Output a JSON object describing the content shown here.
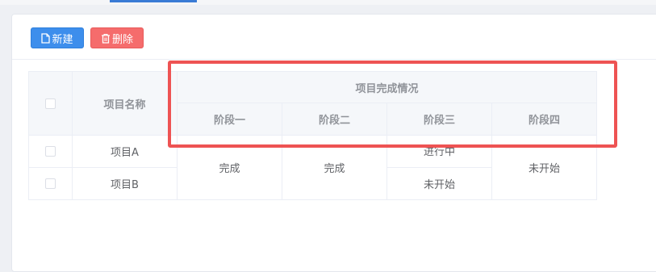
{
  "toolbar": {
    "new_label": "新建",
    "delete_label": "删除"
  },
  "table": {
    "header": {
      "name_col": "项目名称",
      "group_title": "项目完成情况",
      "stages": [
        "阶段一",
        "阶段二",
        "阶段三",
        "阶段四"
      ]
    },
    "rows": [
      {
        "name": "项目A",
        "stage3": "进行中"
      },
      {
        "name": "项目B",
        "stage3": "未开始"
      }
    ],
    "merged": {
      "stage1": "完成",
      "stage2": "完成",
      "stage4": "未开始"
    }
  },
  "colors": {
    "primary": "#3d8eec",
    "danger": "#f56c6c",
    "highlight": "#ee5353"
  },
  "icons": {
    "new": "document-icon",
    "delete": "trash-icon"
  }
}
